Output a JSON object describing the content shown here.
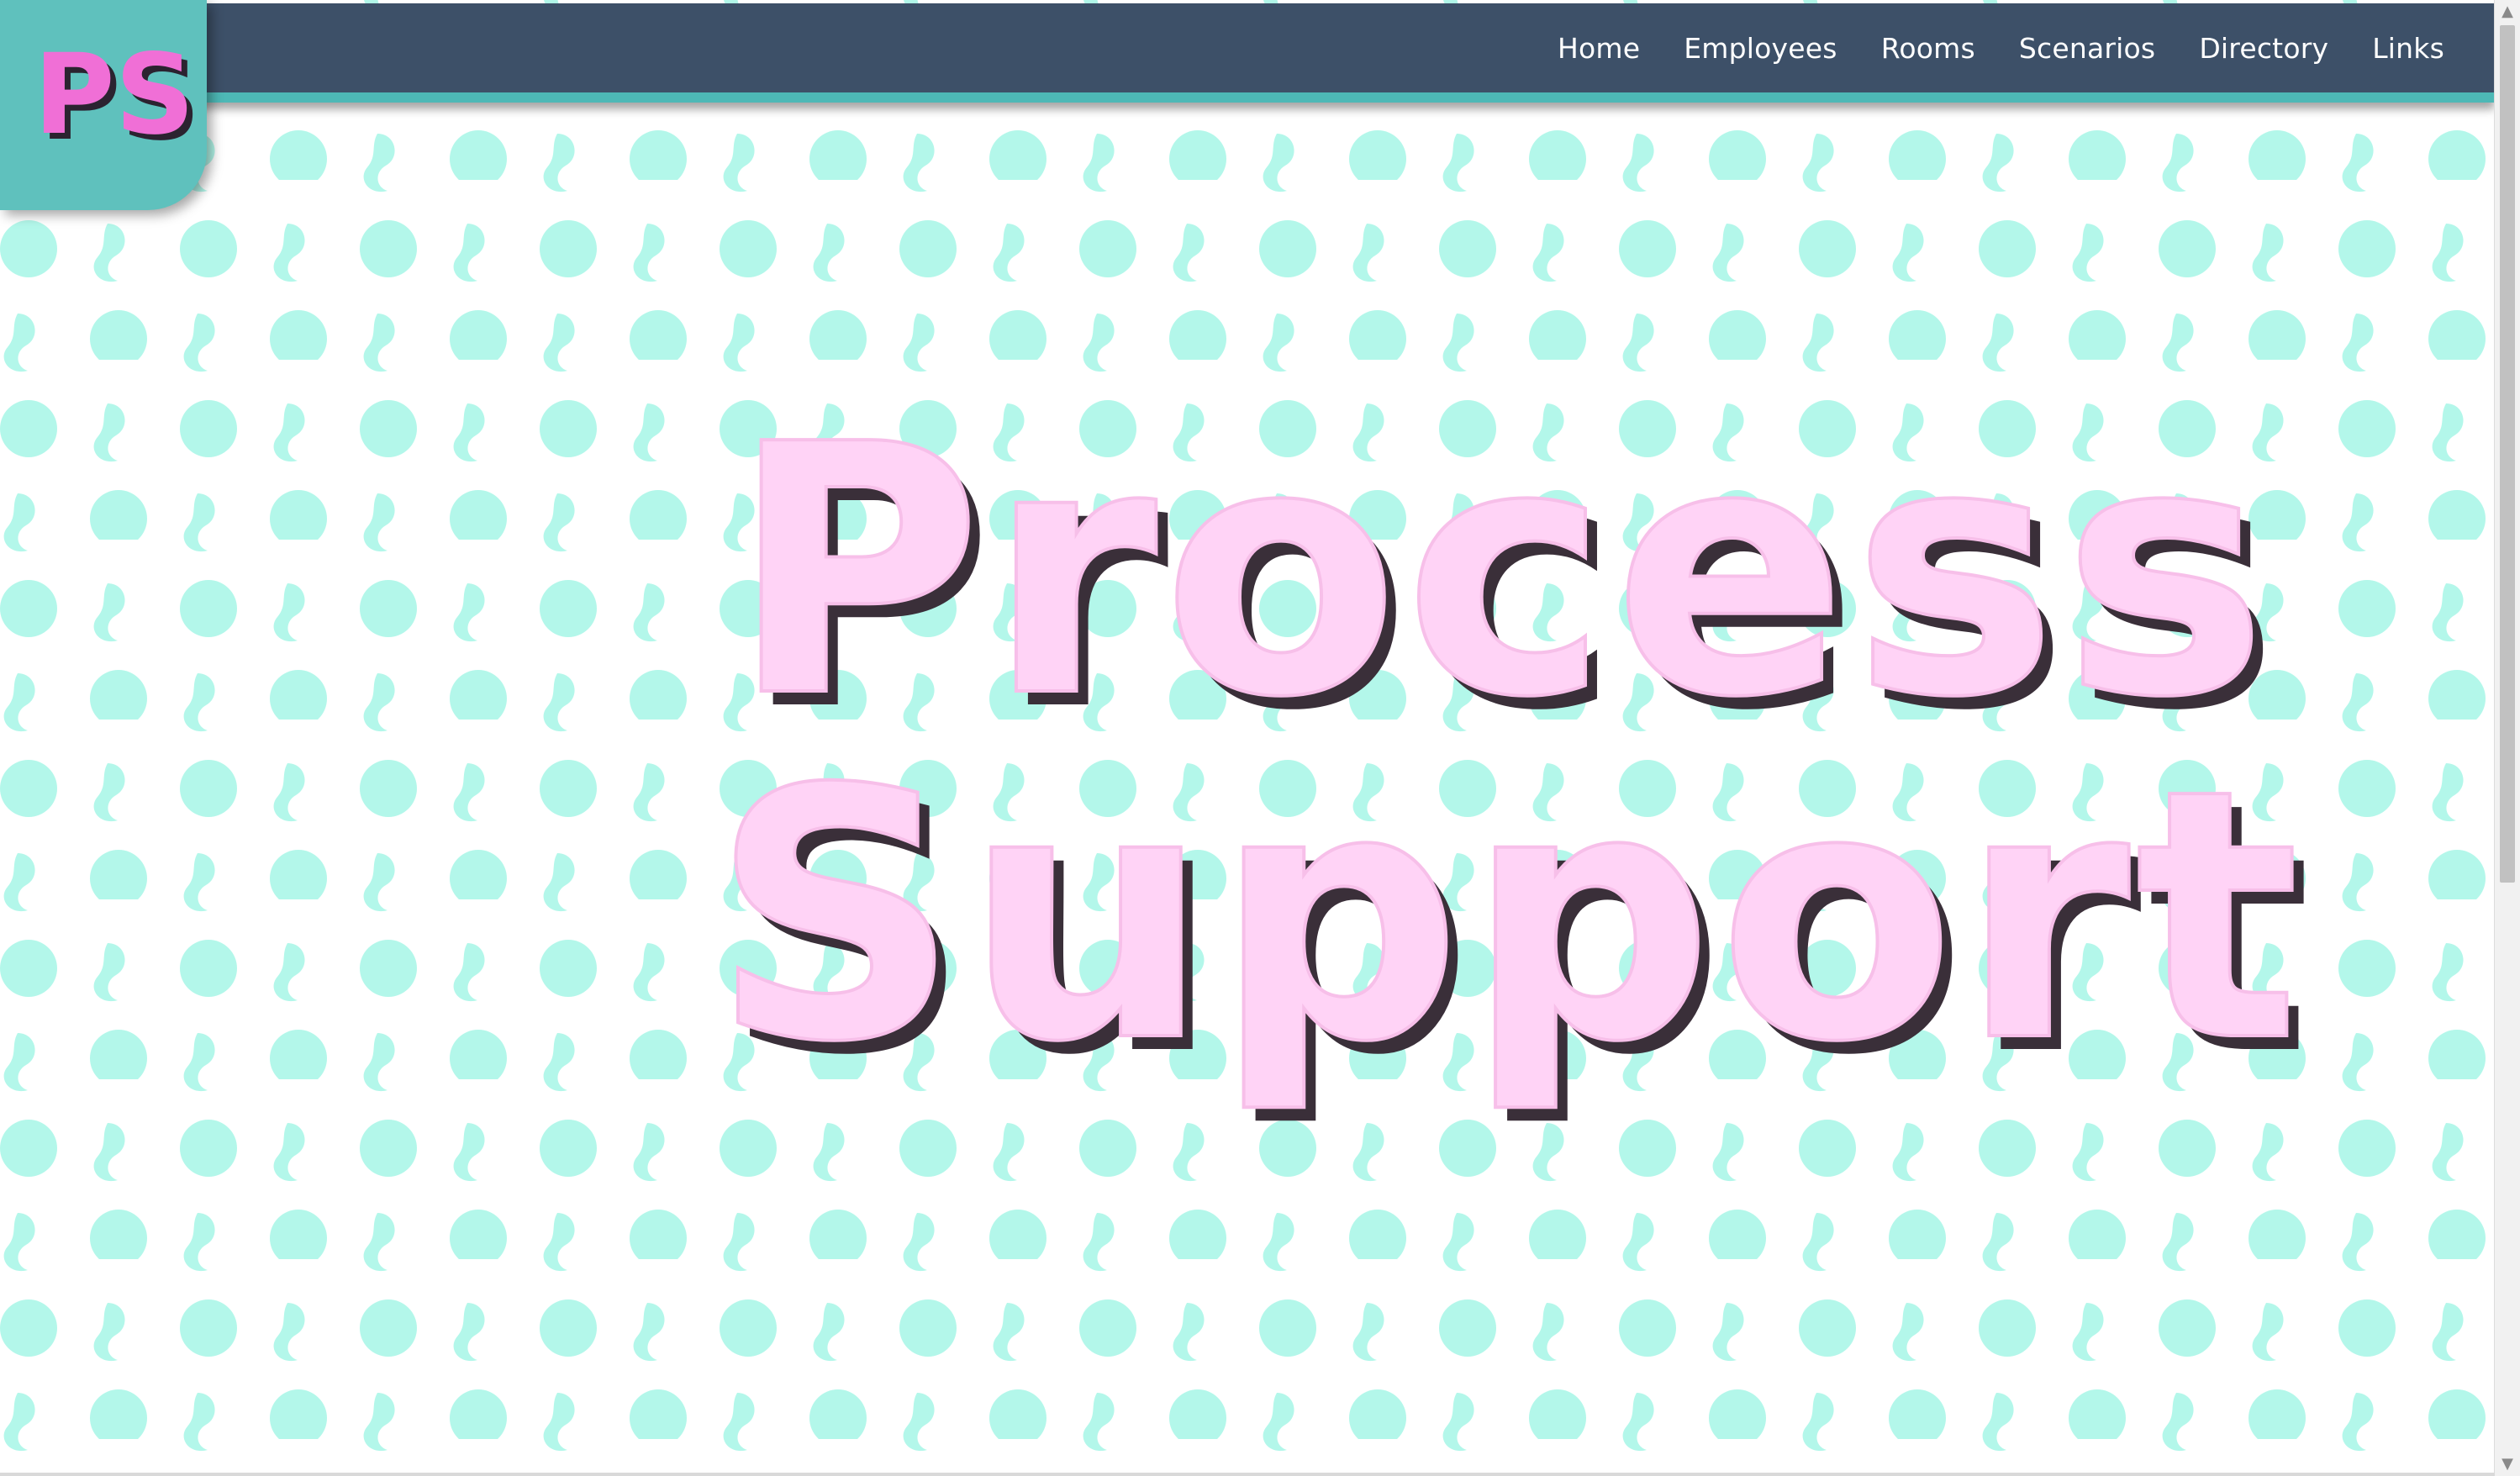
{
  "logo": {
    "text": "PS",
    "alt": "Process Support logo"
  },
  "nav": {
    "items": [
      {
        "label": "Home"
      },
      {
        "label": "Employees"
      },
      {
        "label": "Rooms"
      },
      {
        "label": "Scenarios"
      },
      {
        "label": "Directory"
      },
      {
        "label": "Links"
      }
    ]
  },
  "hero": {
    "line1": "Process",
    "line2": "Support"
  },
  "colors": {
    "navbar": "#3d5068",
    "navbar_accent": "#4db8b6",
    "logo_bg": "#5fc1bd",
    "logo_text": "#f06fd6",
    "pattern": "#b3f7ea",
    "hero_fill": "#ffd3f6",
    "hero_shadow": "#3a2f39"
  },
  "icons": {
    "scroll_up": "scroll-up-arrow-icon",
    "scroll_down": "scroll-down-arrow-icon"
  }
}
